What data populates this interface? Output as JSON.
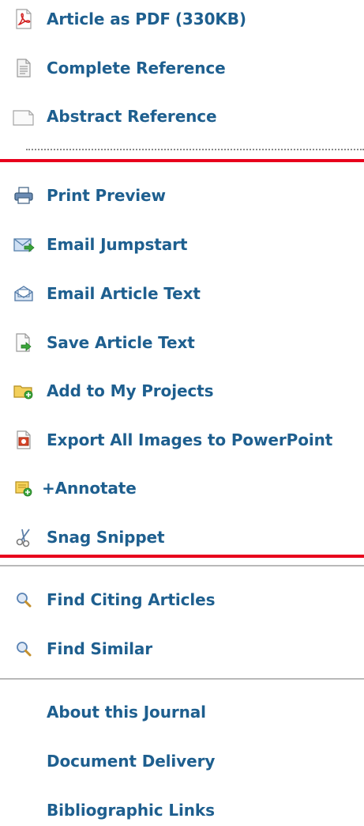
{
  "downloads": {
    "pdf": {
      "label": "Article as PDF",
      "size": "(330KB)",
      "icon": "pdf-icon"
    },
    "complete_reference": {
      "label": "Complete Reference",
      "icon": "document-icon"
    },
    "abstract_reference": {
      "label": "Abstract Reference",
      "icon": "blank-document-icon"
    }
  },
  "tools": [
    {
      "label": "Print Preview",
      "icon": "printer-icon"
    },
    {
      "label": "Email Jumpstart",
      "icon": "email-arrow-icon"
    },
    {
      "label": "Email Article Text",
      "icon": "open-envelope-icon"
    },
    {
      "label": "Save Article Text",
      "icon": "save-document-icon"
    },
    {
      "label": "Add to My Projects",
      "icon": "folder-add-icon"
    },
    {
      "label": "Export All Images to PowerPoint",
      "icon": "powerpoint-icon"
    },
    {
      "label": "+Annotate",
      "icon": "annotate-icon"
    },
    {
      "label": "Snag Snippet",
      "icon": "scissors-icon"
    }
  ],
  "search": [
    {
      "label": "Find Citing Articles",
      "icon": "magnifier-icon"
    },
    {
      "label": "Find Similar",
      "icon": "magnifier-icon"
    }
  ],
  "links": [
    {
      "label": "About this Journal"
    },
    {
      "label": "Document Delivery"
    },
    {
      "label": "Bibliographic Links"
    }
  ],
  "colors": {
    "link": "#1e5f8f",
    "red_divider": "#e8001c",
    "gray_divider": "#b9b9b9"
  }
}
